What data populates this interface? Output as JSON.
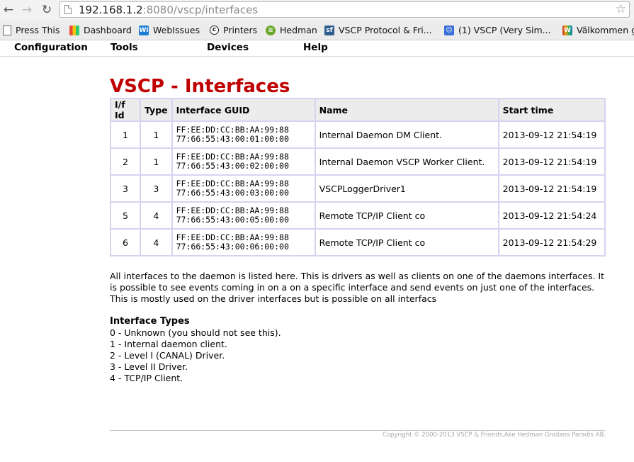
{
  "browser": {
    "url_host": "192.168.1.2",
    "url_rest": ":8080/vscp/interfaces",
    "bookmarks": [
      {
        "label": "Press This",
        "icon": "page-icon",
        "color": "#444444"
      },
      {
        "label": "Dashboard",
        "icon": "dashboard-icon",
        "color": "#2a7ab0"
      },
      {
        "label": "WebIssues",
        "icon": "webissues-icon",
        "color": "#1e7fd4"
      },
      {
        "label": "Printers",
        "icon": "printers-icon",
        "color": "#222222"
      },
      {
        "label": "Hedman",
        "icon": "spotify-icon",
        "color": "#6aa62c"
      },
      {
        "label": "VSCP Protocol & Fri...",
        "icon": "sourceforge-icon",
        "color": "#2f5f8f"
      },
      {
        "label": "(1) VSCP (Very Sim...",
        "icon": "chat-icon",
        "color": "#3b6fd8"
      },
      {
        "label": "Välkommen g",
        "icon": "flag-icon",
        "color": "#c0392b"
      }
    ]
  },
  "menu": [
    "Configuration",
    "Tools",
    "Devices",
    "Help"
  ],
  "page": {
    "title": "VSCP - Interfaces",
    "table": {
      "headers": [
        "I/f Id",
        "Type",
        "Interface GUID",
        "Name",
        "Start time"
      ],
      "rows": [
        {
          "id": "1",
          "type": "1",
          "guid1": "FF:EE:DD:CC:BB:AA:99:88",
          "guid2": "77:66:55:43:00:01:00:00",
          "name": "Internal Daemon DM Client.",
          "start": "2013-09-12 21:54:19"
        },
        {
          "id": "2",
          "type": "1",
          "guid1": "FF:EE:DD:CC:BB:AA:99:88",
          "guid2": "77:66:55:43:00:02:00:00",
          "name": "Internal Daemon VSCP Worker Client.",
          "start": "2013-09-12 21:54:19"
        },
        {
          "id": "3",
          "type": "3",
          "guid1": "FF:EE:DD:CC:BB:AA:99:88",
          "guid2": "77:66:55:43:00:03:00:00",
          "name": "VSCPLoggerDriver1",
          "start": "2013-09-12 21:54:19"
        },
        {
          "id": "5",
          "type": "4",
          "guid1": "FF:EE:DD:CC:BB:AA:99:88",
          "guid2": "77:66:55:43:00:05:00:00",
          "name": "Remote TCP/IP Client co",
          "start": "2013-09-12 21:54:24"
        },
        {
          "id": "6",
          "type": "4",
          "guid1": "FF:EE:DD:CC:BB:AA:99:88",
          "guid2": "77:66:55:43:00:06:00:00",
          "name": "Remote TCP/IP Client co",
          "start": "2013-09-12 21:54:29"
        }
      ]
    },
    "description": "All interfaces to the daemon is listed here. This is drivers as well as clients on one of the daemons interfaces. It is possible to see events coming in on a on a specific interface and send events on just one of the interfaces. This is mostly used on the driver interfaces but is possible on all interfacs",
    "types_title": "Interface Types",
    "types": [
      "0 - Unknown (you should not see this).",
      "1 - Internal daemon client.",
      "2 - Level I (CANAL) Driver.",
      "3 - Level II Driver.",
      "4 - TCP/IP Client."
    ],
    "copyright": "Copyright © 2000-2013 VSCP & Friends,Ake Hedman Grodans Paradis AB."
  },
  "colors": {
    "title": "#c00000",
    "table_border": "#d4d4f0",
    "header_bg": "#ececec"
  }
}
